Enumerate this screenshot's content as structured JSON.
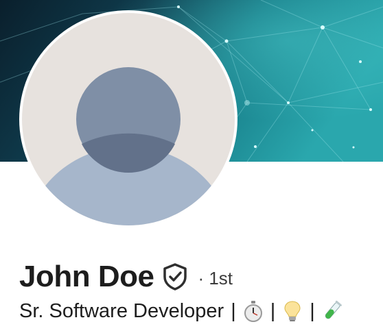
{
  "profile": {
    "name": "John Doe",
    "degree": "· 1st",
    "headline": {
      "title": "Sr. Software Developer",
      "separator": "|",
      "emojis": [
        "stopwatch-emoji",
        "light-bulb-emoji",
        "test-tube-emoji"
      ]
    },
    "badge": "verified-shield-icon"
  },
  "colors": {
    "cover_dark": "#0b2a3a",
    "cover_teal": "#1c8c94",
    "avatar_bg": "#e7e2de",
    "avatar_head": "#7f8fa6",
    "avatar_body": "#a6b6cb",
    "text": "#1d1d1d"
  }
}
